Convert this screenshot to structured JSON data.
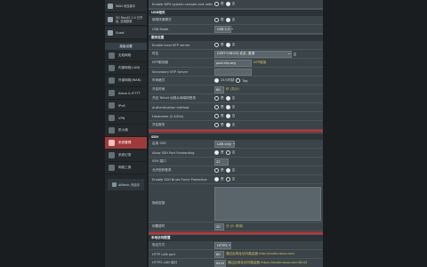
{
  "sidebar": {
    "cards": [
      {
        "icon": "wifi-icon",
        "text": "WAN 未连接中"
      },
      {
        "icon": "router-icon",
        "text": "5G BandX 2.4 已开启, 连接数量"
      },
      {
        "icon": "user-icon",
        "text": "Guest"
      }
    ],
    "section_title": "高级设置",
    "items": [
      {
        "icon": "wireless-icon",
        "label": "无线网络",
        "active": false
      },
      {
        "icon": "lan-icon",
        "label": "内部网络(LAN)",
        "active": false
      },
      {
        "icon": "wan-icon",
        "label": "外部网络(WAN)",
        "active": false
      },
      {
        "icon": "alexa-icon",
        "label": "Alexa & IFTTT",
        "active": false
      },
      {
        "icon": "ipv6-icon",
        "label": "IPv6",
        "active": false
      },
      {
        "icon": "vpn-icon",
        "label": "VPN",
        "active": false
      },
      {
        "icon": "firewall-icon",
        "label": "防火墙",
        "active": false
      },
      {
        "icon": "admin-icon",
        "label": "系统管理",
        "active": true
      },
      {
        "icon": "log-icon",
        "label": "系统记录",
        "active": false
      },
      {
        "icon": "tools-icon",
        "label": "网络工具",
        "active": false
      }
    ],
    "badge": "AiMesh: 开启中"
  },
  "main": {
    "top_row": {
      "label": "Enable WPS system console and netlog",
      "yes": "是",
      "no": "否"
    },
    "usb_section": {
      "title": "USB相关",
      "rows": [
        {
          "label": "使用快速模式",
          "type": "radio",
          "yes": "是",
          "no": "否"
        },
        {
          "label": "USB Mode",
          "type": "select",
          "value": "USB 2.0"
        }
      ]
    },
    "service_section": {
      "title": "服务设置",
      "rows": [
        {
          "label": "Enable local NTP server",
          "type": "radio",
          "yes": "是",
          "no": "否"
        },
        {
          "label": "时区",
          "type": "select",
          "value": "(GMT+08:00) 北京, 香港"
        },
        {
          "label": "NTP服务器",
          "type": "input",
          "value": "pool.ntp.org",
          "note": "NTP链接"
        },
        {
          "label": "Secondary NTP Server",
          "type": "input",
          "value": ""
        },
        {
          "label": "时间格式",
          "type": "radio",
          "yes": "24小时制",
          "no": "Tag"
        },
        {
          "label": "开启时间",
          "type": "number",
          "value": "60",
          "note": "秒 (共计)"
        },
        {
          "label": "开启 Telnet 远程从局域网登录",
          "type": "radio",
          "yes": "是",
          "no": "否"
        },
        {
          "label": "Authentication method",
          "type": "radio",
          "yes": "是",
          "no": "否"
        },
        {
          "label": "Hostname (2.4GHz)",
          "type": "radio",
          "yes": "是",
          "no": "否"
        },
        {
          "label": "开启服务",
          "type": "radio",
          "yes": "是",
          "no": "否"
        }
      ]
    },
    "ssh_section": {
      "title": "SSH",
      "rows": [
        {
          "label": "启用 SSH",
          "type": "select",
          "value": "LAN only"
        },
        {
          "label": "Allow SSH Port Forwarding",
          "type": "radio",
          "yes": "是",
          "no": "否"
        },
        {
          "label": "SSH 端口",
          "type": "input",
          "value": "22"
        },
        {
          "label": "允许密码登录",
          "type": "radio",
          "yes": "是",
          "no": "否"
        },
        {
          "label": "Enable SSH Brute Force Protection",
          "type": "radio",
          "yes": "是",
          "no": "否"
        },
        {
          "label": "授权密钥",
          "type": "textarea",
          "value": ""
        },
        {
          "label": "闲置超时",
          "type": "number",
          "value": "20",
          "note": "分 (0: 停用)"
        }
      ]
    },
    "web_section": {
      "title": "本地访问配置",
      "rows": [
        {
          "label": "验证方式",
          "type": "select",
          "value": "HTTPS"
        },
        {
          "label": "HTTP LAN port",
          "type": "input",
          "value": "80",
          "note": "通过此网址访问路由器 http://router.asus.com"
        },
        {
          "label": "HTTPS LAN 端口",
          "type": "input",
          "value": "8443",
          "note": "通过此网址访问路由器 https://router.asus.com:8443"
        }
      ]
    }
  }
}
